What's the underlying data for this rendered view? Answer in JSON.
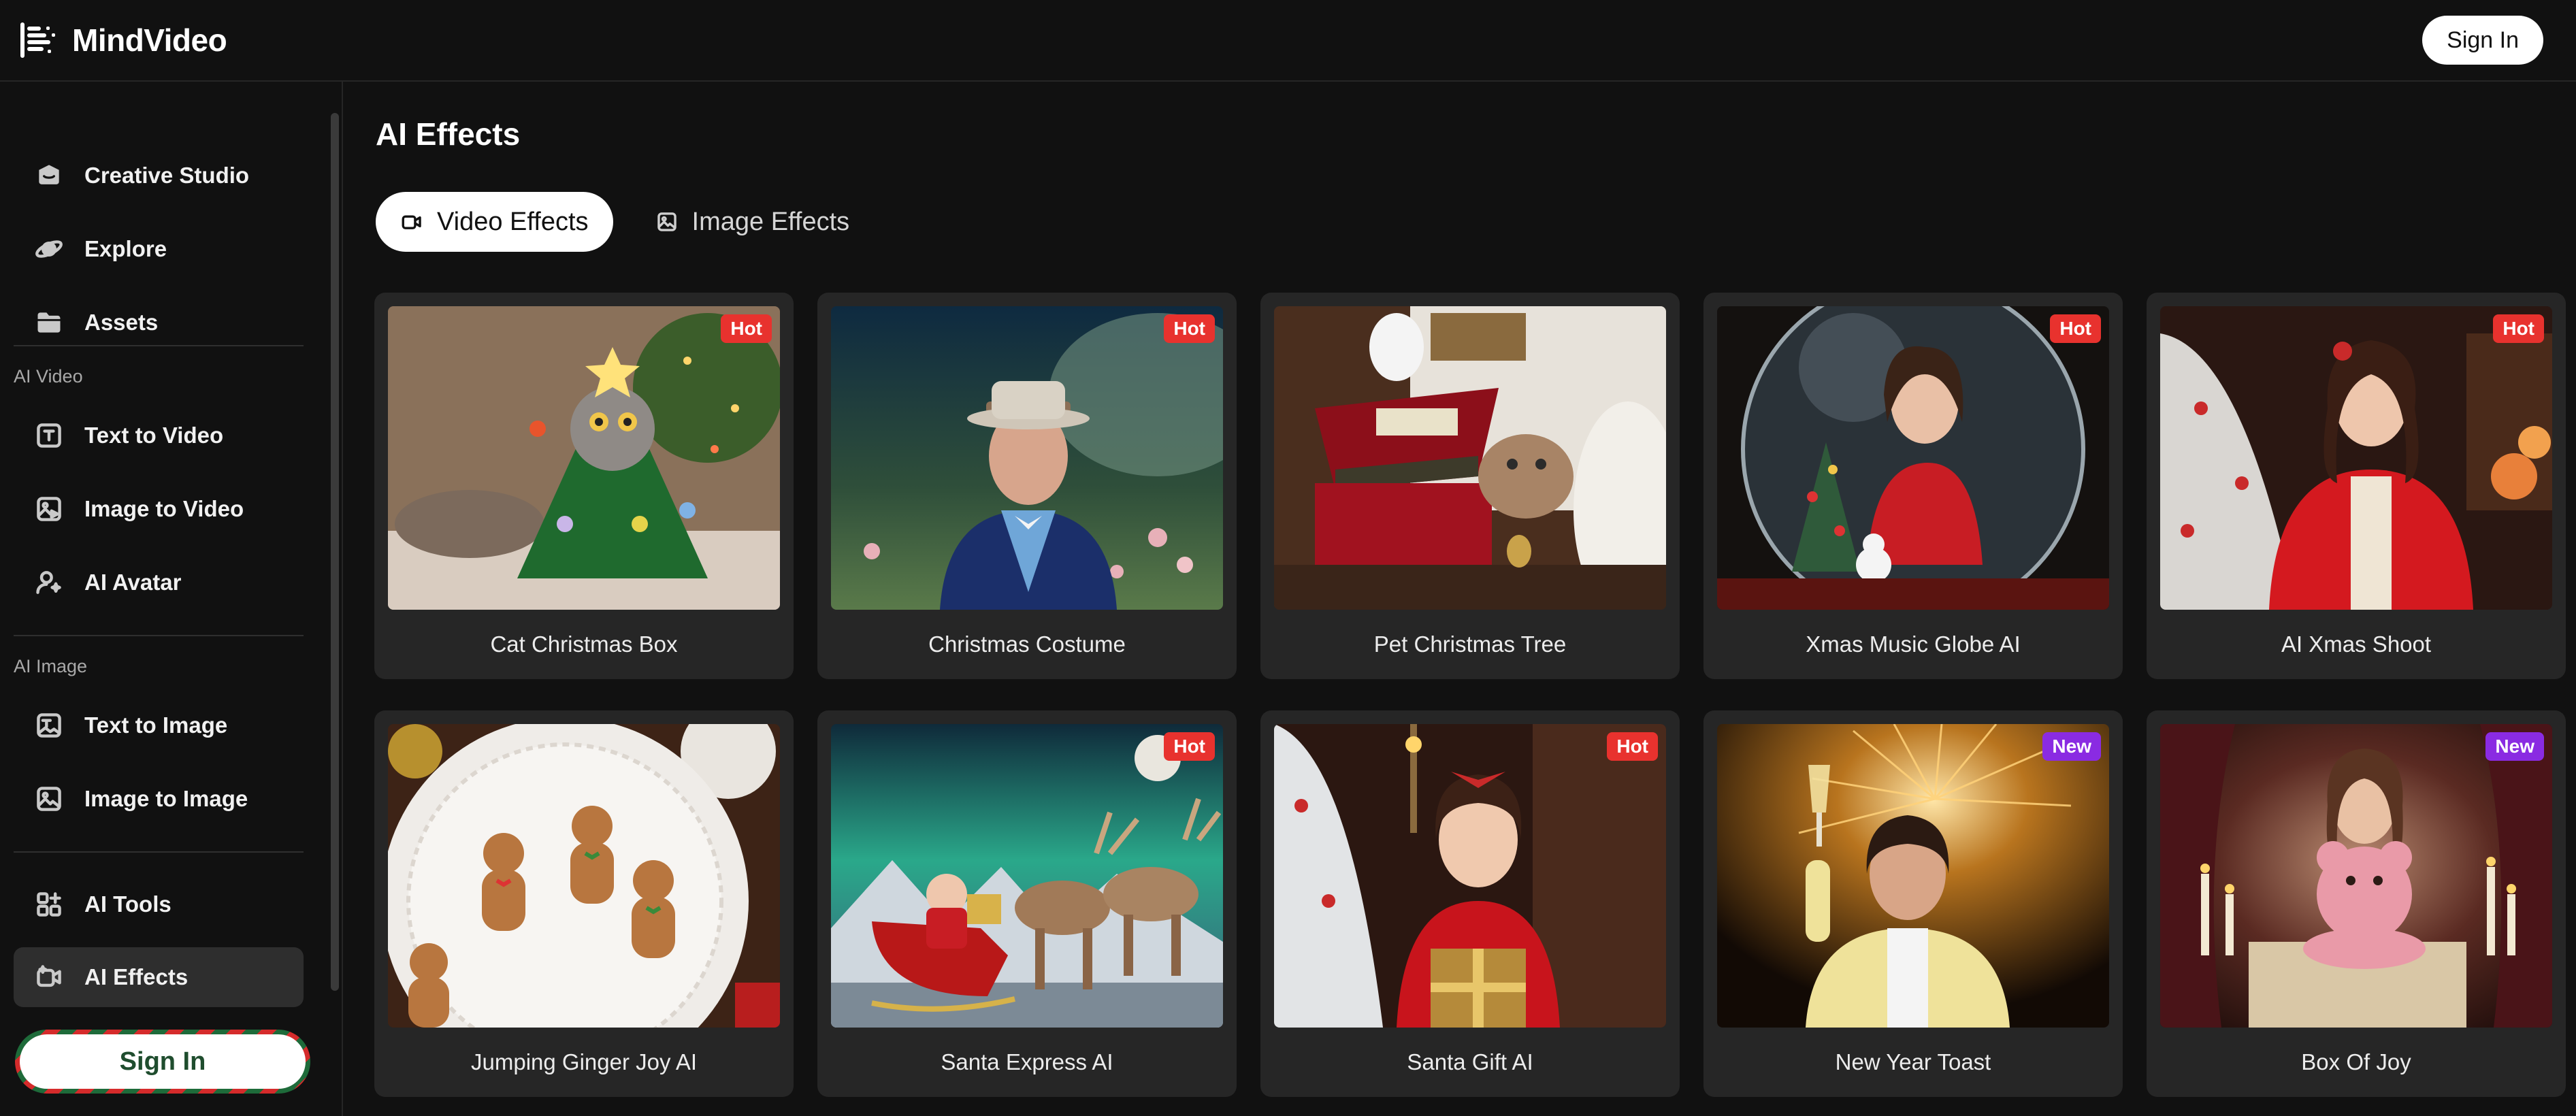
{
  "app": {
    "name": "MindVideo"
  },
  "topbar": {
    "signin_label": "Sign In"
  },
  "sidebar": {
    "top_items": [
      {
        "label": "Creative Studio",
        "icon": "studio-icon"
      },
      {
        "label": "Explore",
        "icon": "planet-icon"
      },
      {
        "label": "Assets",
        "icon": "folder-icon"
      }
    ],
    "groups": [
      {
        "title": "AI Video",
        "items": [
          {
            "label": "Text to Video",
            "icon": "text-to-video-icon"
          },
          {
            "label": "Image to Video",
            "icon": "image-to-video-icon"
          },
          {
            "label": "AI Avatar",
            "icon": "avatar-icon"
          }
        ]
      },
      {
        "title": "AI Image",
        "items": [
          {
            "label": "Text to Image",
            "icon": "text-to-image-icon"
          },
          {
            "label": "Image to Image",
            "icon": "image-to-image-icon"
          }
        ]
      }
    ],
    "bottom_items": [
      {
        "label": "AI Tools",
        "icon": "tools-grid-icon"
      },
      {
        "label": "AI Effects",
        "icon": "effects-icon",
        "active": true
      }
    ],
    "signin_label": "Sign In"
  },
  "main": {
    "title": "AI Effects",
    "tabs": [
      {
        "label": "Video Effects",
        "active": true,
        "icon": "video-effects-icon"
      },
      {
        "label": "Image Effects",
        "active": false,
        "icon": "image-effects-icon"
      }
    ],
    "effects": [
      {
        "title": "Cat Christmas Box",
        "badge": "Hot"
      },
      {
        "title": "Christmas Costume",
        "badge": "Hot"
      },
      {
        "title": "Pet Christmas Tree",
        "badge": ""
      },
      {
        "title": "Xmas Music Globe AI",
        "badge": "Hot"
      },
      {
        "title": "AI Xmas Shoot",
        "badge": "Hot"
      },
      {
        "title": "Jumping Ginger Joy AI",
        "badge": ""
      },
      {
        "title": "Santa Express AI",
        "badge": "Hot"
      },
      {
        "title": "Santa Gift AI",
        "badge": "Hot"
      },
      {
        "title": "New Year Toast",
        "badge": "New"
      },
      {
        "title": "Box Of Joy",
        "badge": "New"
      }
    ]
  },
  "colors": {
    "background": "#111111",
    "card": "#262626",
    "active_nav": "#2e2e2e",
    "hot_badge": "#e8322e",
    "new_badge": "#8a2be2"
  }
}
